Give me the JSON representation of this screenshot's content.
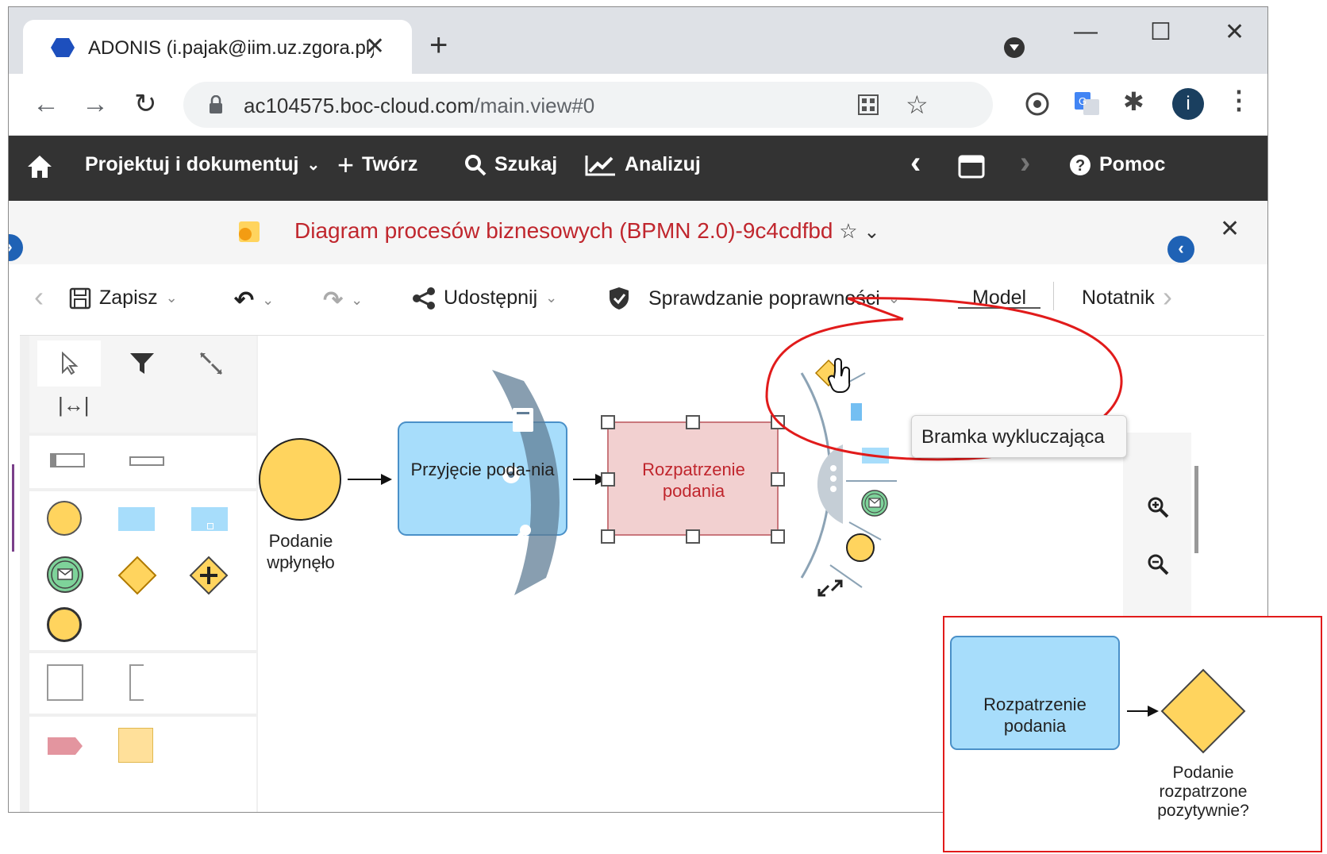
{
  "browser": {
    "tab_title": "ADONIS (i.pajak@iim.uz.zgora.pl)",
    "tab_close": "✕",
    "new_tab": "+",
    "url_host": "ac104575.boc-cloud.com",
    "url_path": "/main.view#0",
    "profile_initial": "i",
    "window_controls": [
      "—",
      "☐",
      "✕"
    ]
  },
  "app_nav": {
    "items": [
      "Projektuj i dokumentuj",
      "Twórz",
      "Szukaj",
      "Analizuj"
    ],
    "help": "Pomoc"
  },
  "diagram": {
    "title": "Diagram procesów biznesowych (BPMN 2.0)-9c4cdfbd",
    "close": "✕"
  },
  "toolbar": {
    "save": "Zapisz",
    "share": "Udostępnij",
    "validate": "Sprawdzanie poprawności",
    "tabs": [
      "Model",
      "Notatnik"
    ]
  },
  "canvas": {
    "start_event_label": "Podanie wpłynęło",
    "task1_label": "Przyjęcie poda-nia",
    "task2_label": "Rozpatrzenie podania",
    "tooltip": "Bramka wykluczająca"
  },
  "inset": {
    "task_label": "Rozpatrzenie podania",
    "gateway_label": "Podanie rozpatrzone pozytywnie?"
  },
  "colors": {
    "event_fill": "#ffd45e",
    "task_fill": "#a7ddfb",
    "task_selected_fill": "#f2d0d0",
    "message_fill": "#7ed39a",
    "accent_red": "#e11b1b",
    "nav_bg": "#333333",
    "title_red": "#c0262d"
  }
}
